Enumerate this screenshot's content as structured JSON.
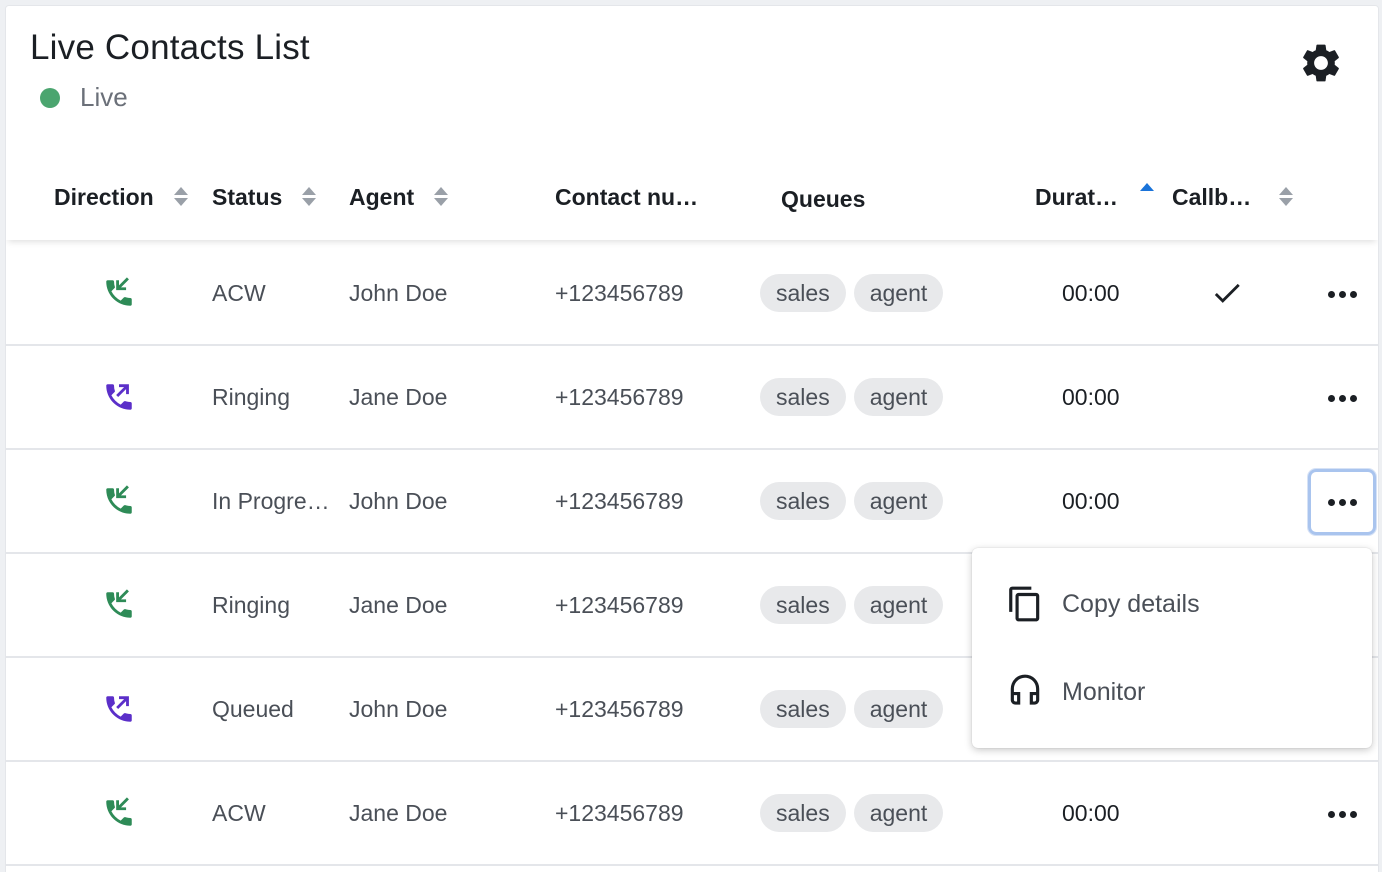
{
  "header": {
    "title": "Live Contacts List",
    "live_label": "Live",
    "live_color": "#4ba56f",
    "settings_icon": "gear-icon"
  },
  "columns": [
    {
      "key": "direction",
      "label": "Direction",
      "sort": "none"
    },
    {
      "key": "status",
      "label": "Status",
      "sort": "none"
    },
    {
      "key": "agent",
      "label": "Agent",
      "sort": "none"
    },
    {
      "key": "contact",
      "label": "Contact nu…"
    },
    {
      "key": "queues",
      "label": "Queues"
    },
    {
      "key": "duration",
      "label": "Durat…",
      "sort": "asc"
    },
    {
      "key": "callback",
      "label": "Callb…",
      "sort": "none"
    }
  ],
  "rows": [
    {
      "direction": "inbound",
      "status": "ACW",
      "agent": "John Doe",
      "contact": "+123456789",
      "queues": [
        "sales",
        "agent"
      ],
      "duration": "00:00",
      "callback": true
    },
    {
      "direction": "outbound",
      "status": "Ringing",
      "agent": "Jane Doe",
      "contact": "+123456789",
      "queues": [
        "sales",
        "agent"
      ],
      "duration": "00:00",
      "callback": false
    },
    {
      "direction": "inbound",
      "status": "In Progre…",
      "agent": "John Doe",
      "contact": "+123456789",
      "queues": [
        "sales",
        "agent"
      ],
      "duration": "00:00",
      "callback": false,
      "menu_open": true
    },
    {
      "direction": "inbound",
      "status": "Ringing",
      "agent": "Jane Doe",
      "contact": "+123456789",
      "queues": [
        "sales",
        "agent"
      ],
      "duration": "",
      "callback": false
    },
    {
      "direction": "outbound",
      "status": "Queued",
      "agent": "John Doe",
      "contact": "+123456789",
      "queues": [
        "sales",
        "agent"
      ],
      "duration": "",
      "callback": false
    },
    {
      "direction": "inbound",
      "status": "ACW",
      "agent": "Jane Doe",
      "contact": "+123456789",
      "queues": [
        "sales",
        "agent"
      ],
      "duration": "00:00",
      "callback": false
    }
  ],
  "colors": {
    "inbound": "#2e8b57",
    "outbound": "#5b2fc9",
    "sort_active": "#1a73d9"
  },
  "context_menu": {
    "items": [
      {
        "label": "Copy details",
        "icon": "copy-icon"
      },
      {
        "label": "Monitor",
        "icon": "headset-icon"
      }
    ]
  }
}
